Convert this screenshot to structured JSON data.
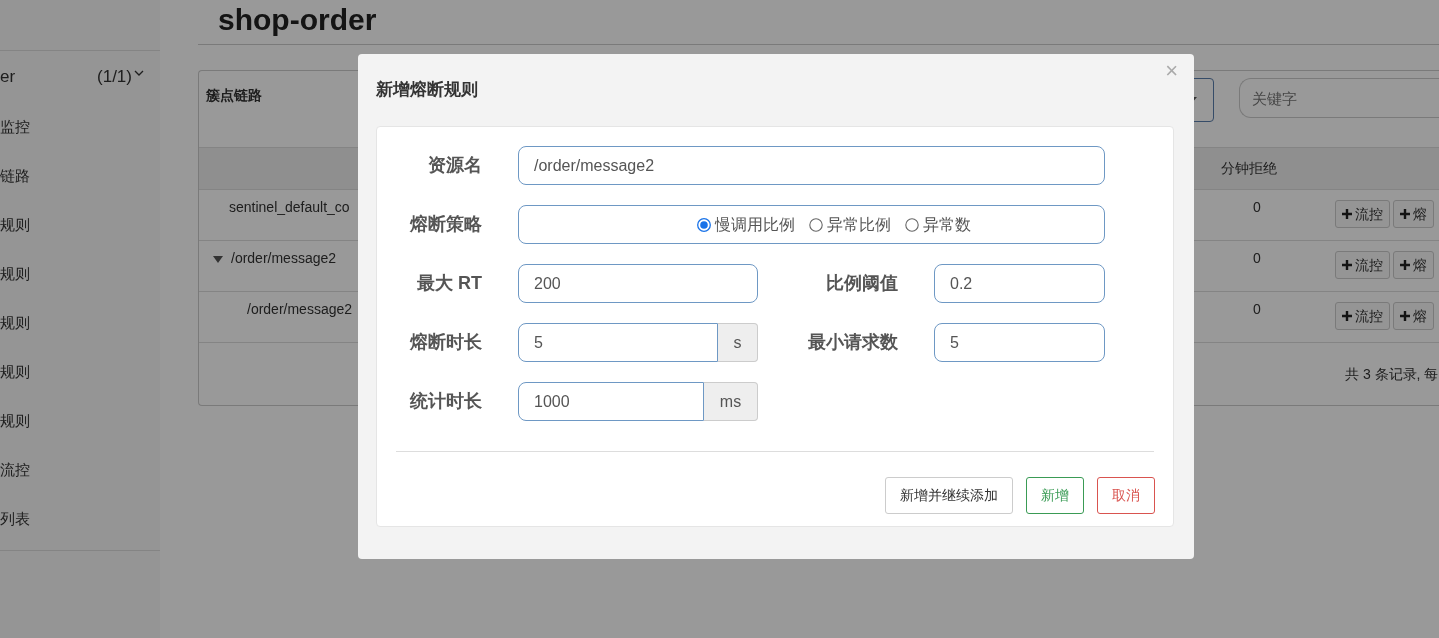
{
  "sidebar": {
    "app": {
      "name": "er",
      "count": "(1/1)",
      "expanded": true
    },
    "items": [
      {
        "label": "监控"
      },
      {
        "label": "链路"
      },
      {
        "label": "规则"
      },
      {
        "label": "规则"
      },
      {
        "label": "规则"
      },
      {
        "label": "规则"
      },
      {
        "label": "规则"
      },
      {
        "label": "流控"
      },
      {
        "label": "列表"
      }
    ]
  },
  "page": {
    "title": "shop-order"
  },
  "cluster": {
    "heading": "簇点链路",
    "keyword_placeholder": "关键字",
    "columns": [
      "分钟拒绝"
    ],
    "rows": [
      {
        "name": "sentinel_default_co",
        "rejected": "0",
        "actions": [
          "流控",
          "熔"
        ]
      },
      {
        "name": "/order/message2",
        "expanded": true,
        "rejected": "0",
        "actions": [
          "流控",
          "熔"
        ],
        "children": [
          {
            "name": "/order/message2",
            "rejected": "0",
            "actions": [
              "流控",
              "熔"
            ]
          }
        ]
      }
    ],
    "footer": "共 3 条记录, 每"
  },
  "dialog": {
    "title": "新增熔断规则",
    "close": "×",
    "resource": {
      "label": "资源名",
      "value": "/order/message2"
    },
    "strategy": {
      "label": "熔断策略",
      "options": [
        {
          "label": "慢调用比例",
          "selected": true
        },
        {
          "label": "异常比例",
          "selected": false
        },
        {
          "label": "异常数",
          "selected": false
        }
      ]
    },
    "max_rt": {
      "label": "最大 RT",
      "value": "200"
    },
    "ratio": {
      "label": "比例阈值",
      "value": "0.2"
    },
    "duration": {
      "label": "熔断时长",
      "value": "5",
      "unit": "s"
    },
    "min_requests": {
      "label": "最小请求数",
      "value": "5"
    },
    "stat_interval": {
      "label": "统计时长",
      "value": "1000",
      "unit": "ms"
    },
    "buttons": [
      {
        "label": "新增并继续添加",
        "kind": "default"
      },
      {
        "label": "新增",
        "kind": "success"
      },
      {
        "label": "取消",
        "kind": "danger"
      }
    ]
  }
}
